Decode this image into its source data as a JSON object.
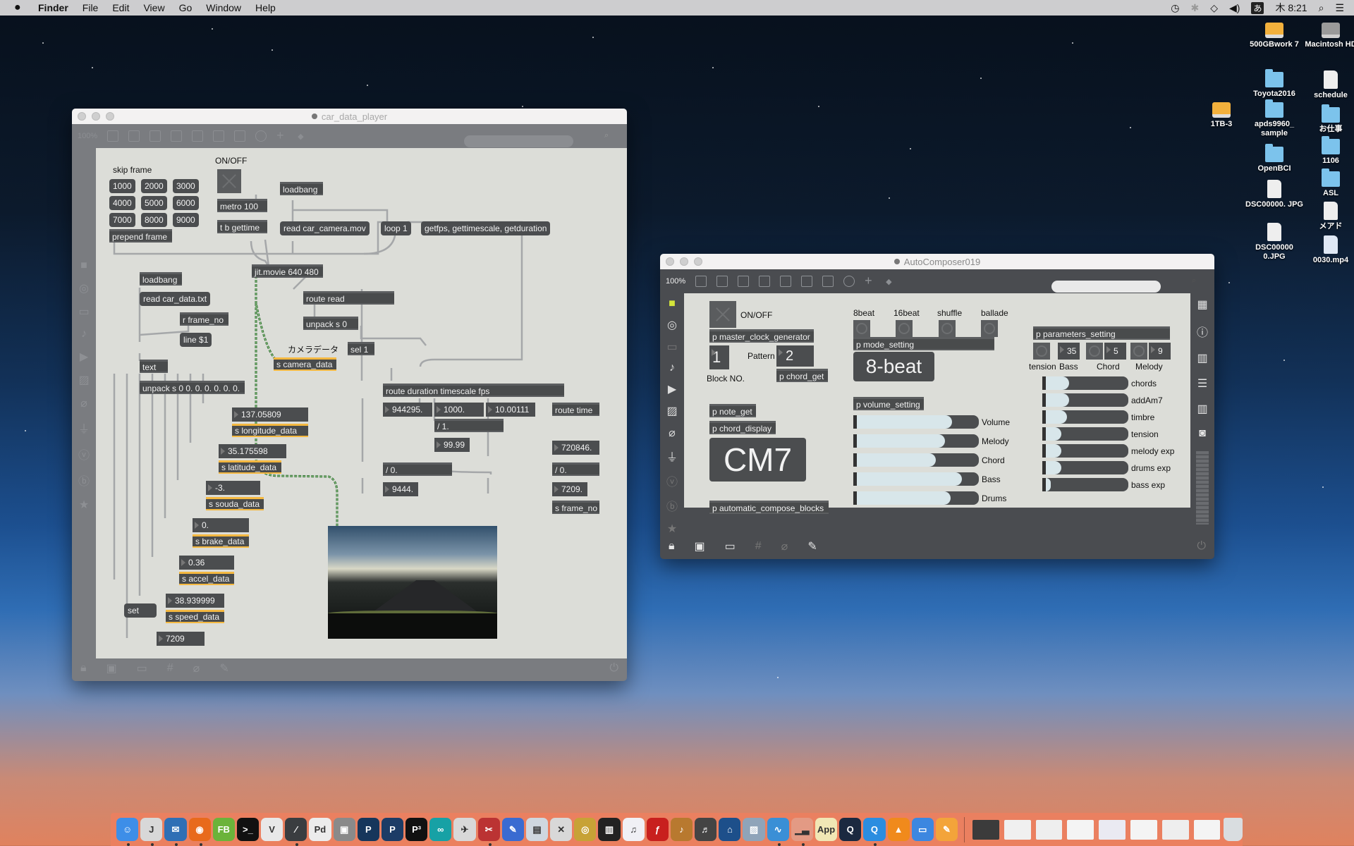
{
  "menubar": {
    "app": "Finder",
    "items": [
      "File",
      "Edit",
      "View",
      "Go",
      "Window",
      "Help"
    ],
    "ime": "あ",
    "clock": "木 8:21"
  },
  "desktop_icons": [
    {
      "label": "500GBwork 7",
      "type": "drive-orange"
    },
    {
      "label": "Macintosh HD",
      "type": "drive-grey"
    },
    {
      "label": "1TB-3",
      "type": "drive-orange"
    },
    {
      "label": "Toyota2016",
      "type": "folder"
    },
    {
      "label": "schedule",
      "type": "file"
    },
    {
      "label": "apds9960_ sample",
      "type": "folder"
    },
    {
      "label": "お仕事",
      "type": "folder"
    },
    {
      "label": "OpenBCI",
      "type": "folder"
    },
    {
      "label": "1106",
      "type": "folder"
    },
    {
      "label": "DSC00000. JPG",
      "type": "file"
    },
    {
      "label": "ASL",
      "type": "folder"
    },
    {
      "label": "DSC00000 0.JPG",
      "type": "file"
    },
    {
      "label": "メアド",
      "type": "file"
    },
    {
      "label": "0030.mp4",
      "type": "movie"
    }
  ],
  "car_window": {
    "title": "car_data_player",
    "zoom": "100%",
    "objects": {
      "skip_label": "skip frame",
      "skip_values": [
        "1000",
        "2000",
        "3000",
        "4000",
        "5000",
        "6000",
        "7000",
        "8000",
        "9000"
      ],
      "prepend": "prepend frame",
      "onoff": "ON/OFF",
      "metro": "metro 100",
      "tb": "t b gettime",
      "loadbang1": "loadbang",
      "read_mov": "read car_camera.mov",
      "loop": "loop 1",
      "getfps": "getfps, gettimescale, getduration",
      "jitmovie": "jit.movie 640 480",
      "loadbang2": "loadbang",
      "read_txt": "read car_data.txt",
      "r_frame": "r frame_no",
      "line": "line $1",
      "text": "text",
      "unpack": "unpack s 0 0. 0. 0. 0. 0. 0.",
      "route_read": "route read",
      "unpack_s0": "unpack s 0",
      "sel1": "sel 1",
      "camera_label": "カメラデータ",
      "s_camera": "s camera_data",
      "longitude": "137.05809",
      "s_longitude": "s longitude_data",
      "latitude": "35.175598",
      "s_latitude": "s latitude_data",
      "souda": "-3.",
      "s_souda": "s souda_data",
      "brake": "0.",
      "s_brake": "s brake_data",
      "accel": "0.36",
      "s_accel": "s accel_data",
      "speed": "38.939999",
      "s_speed": "s speed_data",
      "set": "set",
      "frame_out": "7209",
      "route_dur": "route duration timescale fps",
      "duration": "944295.",
      "timescale": "1000.",
      "fps": "10.00111",
      "route_time": "route time",
      "div1": "/ 1.",
      "div1_out": "99.99",
      "time_val": "720846.",
      "div0a": "/ 0.",
      "div0a_out": "9444.",
      "div0b": "/ 0.",
      "div0b_out": "7209.",
      "s_frame": "s frame_no"
    }
  },
  "auto_window": {
    "title": "AutoComposer019",
    "zoom": "100%",
    "onoff": "ON/OFF",
    "master_clock": "p master_clock_generator",
    "block_no": "1",
    "block_label": "Block NO.",
    "pattern_label": "Pattern",
    "pattern": "2",
    "chord_get": "p chord_get",
    "note_get": "p note_get",
    "chord_display": "p chord_display",
    "chord": "CM7",
    "compose_blocks": "p automatic_compose_blocks",
    "modes": [
      "8beat",
      "16beat",
      "shuffle",
      "ballade"
    ],
    "mode_setting": "p mode_setting",
    "mode_display": "8-beat",
    "volume_setting": "p volume_setting",
    "volumes": [
      {
        "label": "Volume",
        "value": 0.78
      },
      {
        "label": "Melody",
        "value": 0.72
      },
      {
        "label": "Chord",
        "value": 0.65
      },
      {
        "label": "Bass",
        "value": 0.86
      },
      {
        "label": "Drums",
        "value": 0.77
      }
    ],
    "parameters_setting": "p parameters_setting",
    "param_nums": {
      "bass": "35",
      "chord": "5",
      "melody": "9"
    },
    "param_labels": [
      "tension",
      "Bass",
      "Chord",
      "Melody"
    ],
    "params": [
      {
        "label": "chords",
        "value": 0.28
      },
      {
        "label": "addAm7",
        "value": 0.28
      },
      {
        "label": "timbre",
        "value": 0.26
      },
      {
        "label": "tension",
        "value": 0.19
      },
      {
        "label": "melody exp",
        "value": 0.19
      },
      {
        "label": "drums exp",
        "value": 0.19
      },
      {
        "label": "bass exp",
        "value": 0.06
      }
    ]
  },
  "dock": {
    "apps": [
      {
        "name": "finder",
        "glyph": "☺",
        "color": "#3d8ee8",
        "running": true
      },
      {
        "name": "script-editor",
        "glyph": "J",
        "color": "#d8d8d8",
        "running": true
      },
      {
        "name": "thunderbird",
        "glyph": "✉",
        "color": "#2f6fb5",
        "running": true
      },
      {
        "name": "firefox",
        "glyph": "◉",
        "color": "#e86a1c",
        "running": true
      },
      {
        "name": "fb-app",
        "glyph": "FB",
        "color": "#6bb33a",
        "running": false
      },
      {
        "name": "terminal",
        "glyph": ">_",
        "color": "#111111",
        "running": false
      },
      {
        "name": "vnc",
        "glyph": "V",
        "color": "#e8e8e8",
        "running": false
      },
      {
        "name": "max",
        "glyph": "⁄",
        "color": "#3a3d40",
        "running": true
      },
      {
        "name": "pure-data",
        "glyph": "Pd",
        "color": "#ececec",
        "running": false
      },
      {
        "name": "3d-box",
        "glyph": "▣",
        "color": "#8a8a8a",
        "running": false
      },
      {
        "name": "processing-pp",
        "glyph": "P",
        "color": "#16365b",
        "running": false
      },
      {
        "name": "processing",
        "glyph": "P",
        "color": "#1c3c66",
        "running": false
      },
      {
        "name": "p3",
        "glyph": "P³",
        "color": "#111111",
        "running": false
      },
      {
        "name": "arduino",
        "glyph": "∞",
        "color": "#17a1a5",
        "running": false
      },
      {
        "name": "linux-tool",
        "glyph": "✈",
        "color": "#d8d8d8",
        "running": false
      },
      {
        "name": "pliers-app",
        "glyph": "✂",
        "color": "#b33",
        "running": true
      },
      {
        "name": "xcode-instr",
        "glyph": "✎",
        "color": "#3a6bd1",
        "running": false
      },
      {
        "name": "preview",
        "glyph": "▤",
        "color": "#cfd7df",
        "running": false
      },
      {
        "name": "tools",
        "glyph": "✕",
        "color": "#d8d8d8",
        "running": false
      },
      {
        "name": "disc-app",
        "glyph": "◎",
        "color": "#c7a236",
        "running": false
      },
      {
        "name": "piano",
        "glyph": "▥",
        "color": "#222222",
        "running": false
      },
      {
        "name": "itunes",
        "glyph": "♫",
        "color": "#f0f0f5",
        "running": false
      },
      {
        "name": "flash",
        "glyph": "ƒ",
        "color": "#c8201e",
        "running": false
      },
      {
        "name": "garageband",
        "glyph": "♪",
        "color": "#b8792f",
        "running": false
      },
      {
        "name": "itunes-helper",
        "glyph": "♬",
        "color": "#444444",
        "running": false
      },
      {
        "name": "home-app",
        "glyph": "⌂",
        "color": "#1d4f8a",
        "running": false
      },
      {
        "name": "image-capture",
        "glyph": "▨",
        "color": "#8fa4b9",
        "running": false
      },
      {
        "name": "intel-power",
        "glyph": "∿",
        "color": "#3a8fd6",
        "running": true
      },
      {
        "name": "audio-app",
        "glyph": "▁▃",
        "color": "#e39a84",
        "running": true
      },
      {
        "name": "app-folder",
        "glyph": "App",
        "color": "#f1e7b5",
        "running": false
      },
      {
        "name": "quicktime-x",
        "glyph": "Q",
        "color": "#1b2940",
        "running": false
      },
      {
        "name": "quicktime",
        "glyph": "Q",
        "color": "#2b8de0",
        "running": true
      },
      {
        "name": "vlc",
        "glyph": "▲",
        "color": "#f08a1c",
        "running": false
      },
      {
        "name": "keynote",
        "glyph": "▭",
        "color": "#3c87e0",
        "running": false
      },
      {
        "name": "pages",
        "glyph": "✎",
        "color": "#f3a43a",
        "running": false
      }
    ],
    "minimized": [
      {
        "name": "minimized-video",
        "color": "#3b3b3b"
      },
      {
        "name": "minimized-mail",
        "color": "#f0f0f0"
      },
      {
        "name": "minimized-quicktime",
        "color": "#eeeeee"
      },
      {
        "name": "minimized-doc-1",
        "color": "#f4f4f4"
      },
      {
        "name": "minimized-firefox",
        "color": "#eaeaf2"
      },
      {
        "name": "minimized-doc-2",
        "color": "#f4f4f4"
      },
      {
        "name": "minimized-terminal",
        "color": "#eeeeee"
      },
      {
        "name": "minimized-doc-3",
        "color": "#f4f4f4"
      }
    ],
    "trash": "trash"
  }
}
